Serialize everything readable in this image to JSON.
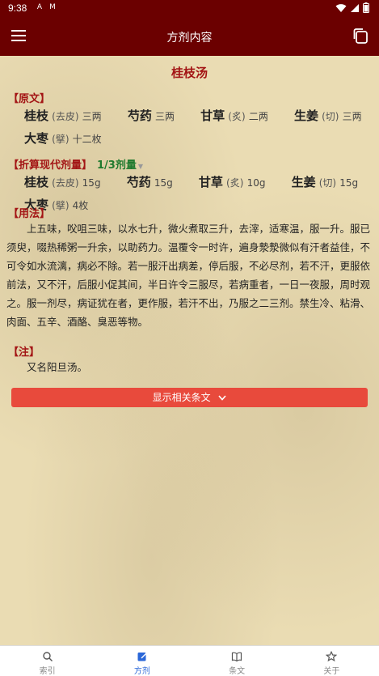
{
  "status": {
    "time": "9:38",
    "icons": [
      "A",
      "M"
    ]
  },
  "appbar": {
    "title": "方剂内容"
  },
  "formula": {
    "title": "桂枝汤",
    "original_label": "【原文】",
    "original_herbs": [
      {
        "name": "桂枝",
        "prep": "(去皮)",
        "dose": "三两"
      },
      {
        "name": "芍药",
        "prep": "",
        "dose": "三两"
      },
      {
        "name": "甘草",
        "prep": "(炙)",
        "dose": "二两"
      },
      {
        "name": "生姜",
        "prep": "(切)",
        "dose": "三两"
      },
      {
        "name": "大枣",
        "prep": "(擘)",
        "dose": "十二枚"
      }
    ],
    "modern_label": "【折算现代剂量】",
    "ratio": "1/3剂量",
    "modern_herbs": [
      {
        "name": "桂枝",
        "prep": "(去皮)",
        "dose": "15g"
      },
      {
        "name": "芍药",
        "prep": "",
        "dose": "15g"
      },
      {
        "name": "甘草",
        "prep": "(炙)",
        "dose": "10g"
      },
      {
        "name": "生姜",
        "prep": "(切)",
        "dose": "15g"
      },
      {
        "name": "大枣",
        "prep": "(擘)",
        "dose": "4枚"
      }
    ],
    "usage_label": "【用法】",
    "usage_text": "上五味，㕮咀三味，以水七升，微火煮取三升，去滓，适寒温，服一升。服已须臾，啜热稀粥一升余，以助药力。温覆令一时许，遍身漐漐微似有汗者益佳，不可令如水流漓，病必不除。若一服汗出病差，停后服，不必尽剂，若不汗，更服依前法，又不汗，后服小促其间，半日许令三服尽，若病重者，一日一夜服，周时观之。服一剂尽，病证犹在者，更作服，若汗不出，乃服之二三剂。禁生冷、粘滑、肉面、五辛、酒酪、臭恶等物。",
    "note_label": "【注】",
    "note_text": "又名阳旦汤。",
    "show_related": "显示相关条文"
  },
  "nav": [
    {
      "label": "索引",
      "icon": "search-icon"
    },
    {
      "label": "方剂",
      "icon": "edit-icon",
      "active": true
    },
    {
      "label": "条文",
      "icon": "book-icon"
    },
    {
      "label": "关于",
      "icon": "star-icon"
    }
  ],
  "colors": {
    "primary": "#6b0000",
    "accent_red": "#a31515",
    "button": "#e84a3c",
    "active_nav": "#2a67d8",
    "ratio_green": "#1f7a2e"
  }
}
